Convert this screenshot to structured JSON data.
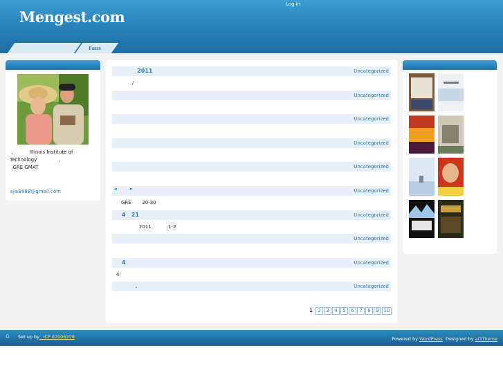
{
  "header": {
    "login_label": "Log in",
    "site_title": "Mengest.com",
    "nav_tab_label": "Fans"
  },
  "left_sidebar": {
    "bio_line1": " ,           Illinois Institute of",
    "bio_line2": "Technology              ,",
    "bio_line3": " ,GRE GMAT",
    "email": "ajie8888@gmail.com"
  },
  "posts": [
    {
      "title": "             2011",
      "category": "Uncategorized",
      "excerpt": "             /"
    },
    {
      "title": "",
      "category": "Uncategorized",
      "excerpt": ""
    },
    {
      "title": "",
      "category": "Uncategorized",
      "excerpt": ""
    },
    {
      "title": "",
      "category": "Uncategorized",
      "excerpt": ""
    },
    {
      "title": "",
      "category": "Uncategorized",
      "excerpt": ""
    },
    {
      "title": " “      ”",
      "category": "Uncategorized",
      "excerpt": "GRE       20-30"
    },
    {
      "title": "     4   21",
      "category": "Uncategorized",
      "excerpt": "        2011           1-2"
    },
    {
      "title": "",
      "category": "Uncategorized",
      "excerpt": ""
    },
    {
      "title": "     4",
      "category": "Uncategorized",
      "excerpt": "4"
    },
    {
      "title": "            .",
      "category": "Uncategorized",
      "excerpt": ""
    }
  ],
  "pagination": {
    "current": "1",
    "pages": [
      "2",
      "3",
      "4",
      "5",
      "6",
      "7",
      "8",
      "9",
      "10"
    ]
  },
  "footer": {
    "setup_label": "Set up by",
    "icp_link": "_ ICP 07006378",
    "powered_prefix": "Powered by ",
    "wordpress_link": "WordPress",
    "designed_prefix": "  Designed by ",
    "theme_link": "ai3Theme"
  },
  "colors": {
    "header_blue": "#2a86bd",
    "link_blue": "#2f7bb5",
    "post_bar": "#e7eef5",
    "footer_link": "#ffe37a"
  }
}
